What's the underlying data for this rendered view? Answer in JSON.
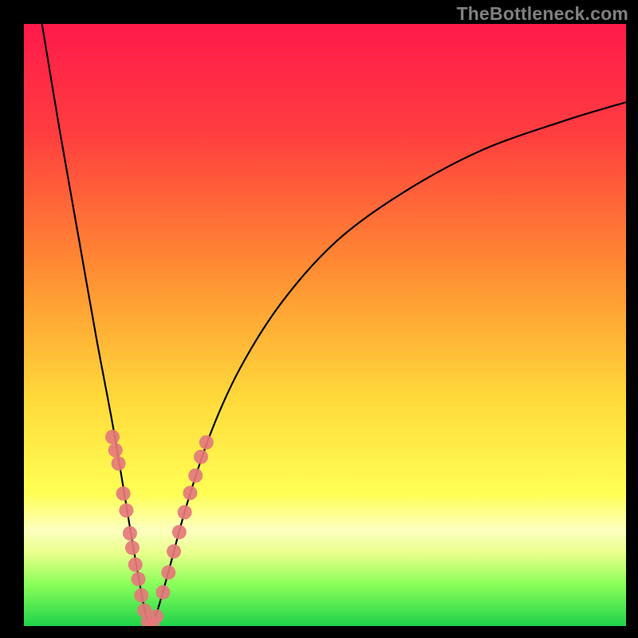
{
  "watermark": "TheBottleneck.com",
  "colors": {
    "frame_bg": "#000000",
    "grad_top": "#ff1a4b",
    "grad_mid1": "#ff7a33",
    "grad_mid2": "#ffe23a",
    "grad_lower": "#fdff7a",
    "grad_band": "#d8ff60",
    "grad_green": "#1fd34a",
    "curve": "#000000",
    "dots": "#e4787b"
  },
  "chart_data": {
    "type": "line",
    "title": "",
    "xlabel": "",
    "ylabel": "",
    "xlim": [
      0,
      100
    ],
    "ylim": [
      0,
      100
    ],
    "curve": {
      "name": "bottleneck-curve",
      "vertex_x": 21,
      "points": [
        {
          "x": 3,
          "y": 100
        },
        {
          "x": 6,
          "y": 82
        },
        {
          "x": 9,
          "y": 65
        },
        {
          "x": 12,
          "y": 48
        },
        {
          "x": 15,
          "y": 32
        },
        {
          "x": 18,
          "y": 14
        },
        {
          "x": 20,
          "y": 3
        },
        {
          "x": 21,
          "y": 0
        },
        {
          "x": 22,
          "y": 2
        },
        {
          "x": 24,
          "y": 9
        },
        {
          "x": 27,
          "y": 20
        },
        {
          "x": 31,
          "y": 32
        },
        {
          "x": 36,
          "y": 43
        },
        {
          "x": 43,
          "y": 54
        },
        {
          "x": 52,
          "y": 64
        },
        {
          "x": 63,
          "y": 72
        },
        {
          "x": 76,
          "y": 79
        },
        {
          "x": 90,
          "y": 84
        },
        {
          "x": 100,
          "y": 87
        }
      ]
    },
    "scatter": {
      "name": "sample-points",
      "points": [
        {
          "x": 14.7,
          "y": 31.4
        },
        {
          "x": 15.2,
          "y": 29.2
        },
        {
          "x": 15.7,
          "y": 27.0
        },
        {
          "x": 16.5,
          "y": 22.0
        },
        {
          "x": 17.0,
          "y": 19.2
        },
        {
          "x": 17.6,
          "y": 15.4
        },
        {
          "x": 18.0,
          "y": 13.0
        },
        {
          "x": 18.5,
          "y": 10.2
        },
        {
          "x": 19.0,
          "y": 7.8
        },
        {
          "x": 19.5,
          "y": 5.1
        },
        {
          "x": 20.0,
          "y": 2.6
        },
        {
          "x": 20.6,
          "y": 0.7
        },
        {
          "x": 21.3,
          "y": 0.4
        },
        {
          "x": 22.0,
          "y": 1.6
        },
        {
          "x": 23.1,
          "y": 5.6
        },
        {
          "x": 24.0,
          "y": 8.9
        },
        {
          "x": 24.9,
          "y": 12.4
        },
        {
          "x": 25.8,
          "y": 15.6
        },
        {
          "x": 26.7,
          "y": 18.9
        },
        {
          "x": 27.6,
          "y": 22.1
        },
        {
          "x": 28.5,
          "y": 25.0
        },
        {
          "x": 29.4,
          "y": 28.1
        },
        {
          "x": 30.3,
          "y": 30.5
        }
      ]
    },
    "gradient_stops": [
      {
        "pct": 0,
        "color": "#ff1a4b"
      },
      {
        "pct": 18,
        "color": "#ff3d3f"
      },
      {
        "pct": 40,
        "color": "#ff8a33"
      },
      {
        "pct": 62,
        "color": "#ffd93a"
      },
      {
        "pct": 78,
        "color": "#ffff55"
      },
      {
        "pct": 84,
        "color": "#fdffbf"
      },
      {
        "pct": 88,
        "color": "#e8ff8a"
      },
      {
        "pct": 93,
        "color": "#8bff5a"
      },
      {
        "pct": 100,
        "color": "#1fd34a"
      }
    ]
  }
}
